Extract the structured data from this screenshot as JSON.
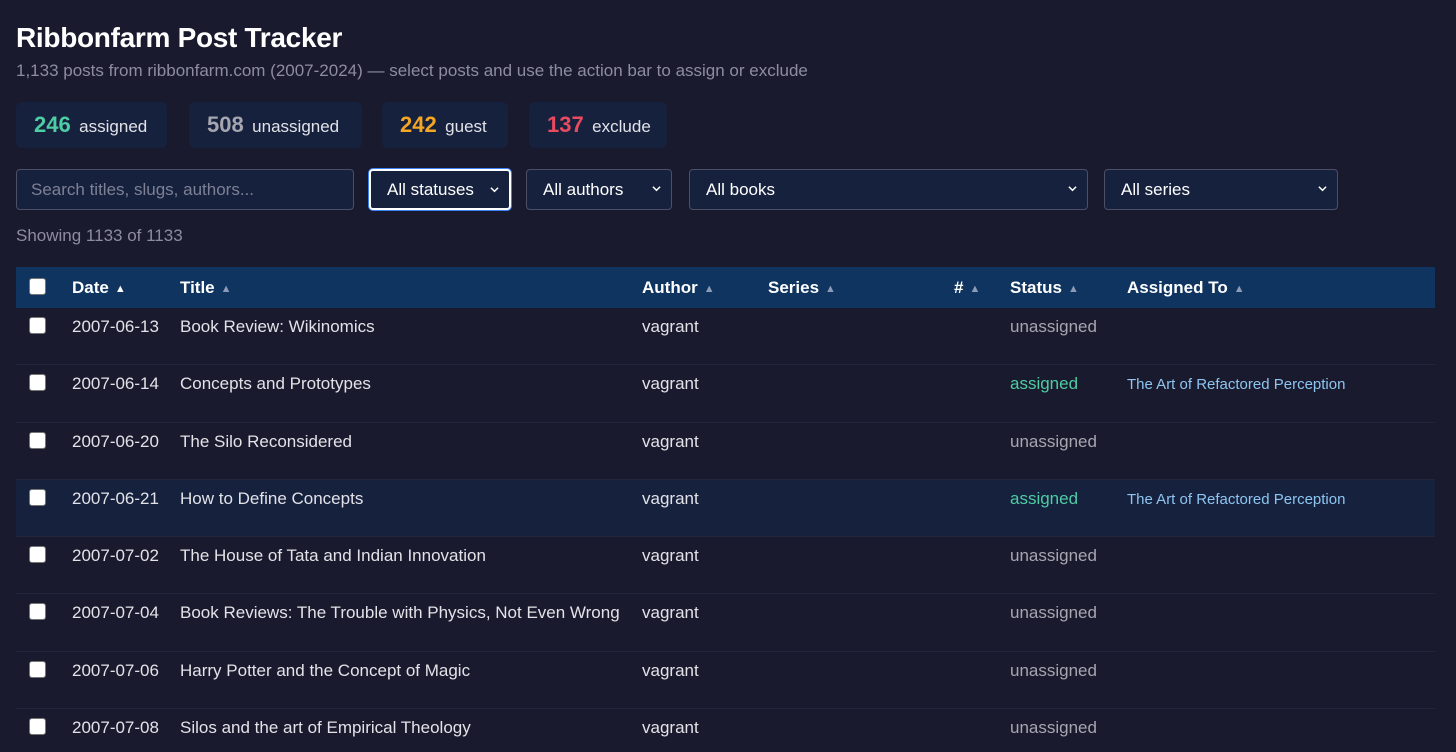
{
  "header": {
    "title": "Ribbonfarm Post Tracker",
    "subtitle": "1,133 posts from ribbonfarm.com (2007-2024) — select posts and use the action bar to assign or exclude"
  },
  "stats": [
    {
      "count": "246",
      "label": "assigned",
      "color": "#4ecca3"
    },
    {
      "count": "508",
      "label": "unassigned",
      "color": "#a6a6b0"
    },
    {
      "count": "242",
      "label": "guest",
      "color": "#f5a623"
    },
    {
      "count": "137",
      "label": "exclude",
      "color": "#e84a5f"
    }
  ],
  "filters": {
    "search_placeholder": "Search titles, slugs, authors...",
    "status": "All statuses",
    "authors": "All authors",
    "books": "All books",
    "series": "All series"
  },
  "showing": "Showing 1133 of 1133",
  "table": {
    "columns": {
      "date": "Date",
      "title": "Title",
      "author": "Author",
      "series": "Series",
      "number": "#",
      "status": "Status",
      "assigned_to": "Assigned To"
    },
    "sort_arrow": "▲",
    "rows": [
      {
        "date": "2007-06-13",
        "title": "Book Review: Wikinomics",
        "author": "vagrant",
        "status": "unassigned",
        "assigned_to": ""
      },
      {
        "date": "2007-06-14",
        "title": "Concepts and Prototypes",
        "author": "vagrant",
        "status": "assigned",
        "assigned_to": "The Art of Refactored Perception"
      },
      {
        "date": "2007-06-20",
        "title": "The Silo Reconsidered",
        "author": "vagrant",
        "status": "unassigned",
        "assigned_to": ""
      },
      {
        "date": "2007-06-21",
        "title": "How to Define Concepts",
        "author": "vagrant",
        "status": "assigned",
        "assigned_to": "The Art of Refactored Perception"
      },
      {
        "date": "2007-07-02",
        "title": "The House of Tata and Indian Innovation",
        "author": "vagrant",
        "status": "unassigned",
        "assigned_to": ""
      },
      {
        "date": "2007-07-04",
        "title": "Book Reviews: The Trouble with Physics, Not Even Wrong",
        "author": "vagrant",
        "status": "unassigned",
        "assigned_to": ""
      },
      {
        "date": "2007-07-06",
        "title": "Harry Potter and the Concept of Magic",
        "author": "vagrant",
        "status": "unassigned",
        "assigned_to": ""
      },
      {
        "date": "2007-07-08",
        "title": "Silos and the art of Empirical Theology",
        "author": "vagrant",
        "status": "unassigned",
        "assigned_to": ""
      }
    ]
  }
}
